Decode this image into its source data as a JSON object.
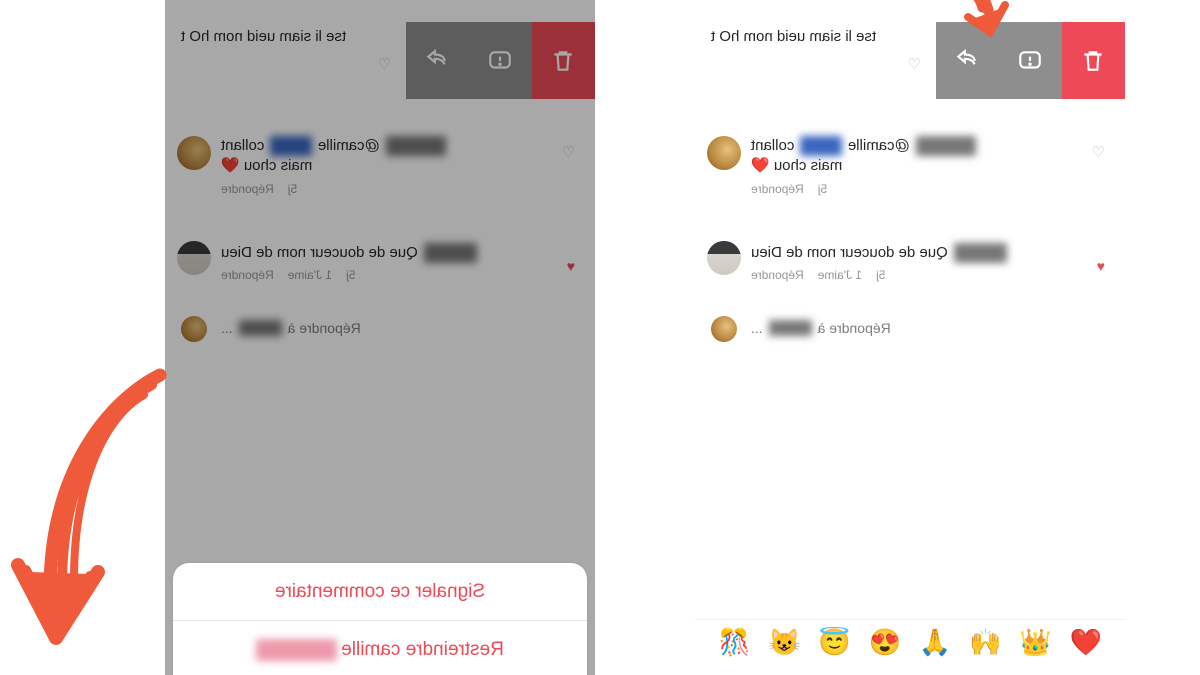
{
  "colors": {
    "danger": "#ed4956",
    "grayBtn": "#8e8e8e",
    "arrow": "#ef5a3a"
  },
  "partial_comment": "t Oh mon dieu mais il est",
  "comments": {
    "c1": {
      "mention": "@camille",
      "tail": "collant",
      "line2_prefix": "mais chou",
      "heart_emoji": "❤️",
      "age": "5j",
      "reply": "Répondre"
    },
    "c2": {
      "text": "Que de douceur nom de Dieu",
      "age": "5j",
      "likes": "1 J'aime",
      "reply": "Répondre"
    },
    "c3": {
      "prefix": "Répondre à",
      "suffix": "..."
    }
  },
  "sheet": {
    "report": "Signaler ce commentaire",
    "restrict": "Restreindre camille"
  },
  "reactions": [
    "❤️",
    "👑",
    "🙌",
    "🙏",
    "😍",
    "😇",
    "😺",
    "🎊"
  ],
  "icons": {
    "trash": "trash",
    "warn": "exclamation-bubble",
    "share": "share-arrow",
    "heart_outline": "♡",
    "heart_fill": "♥"
  }
}
